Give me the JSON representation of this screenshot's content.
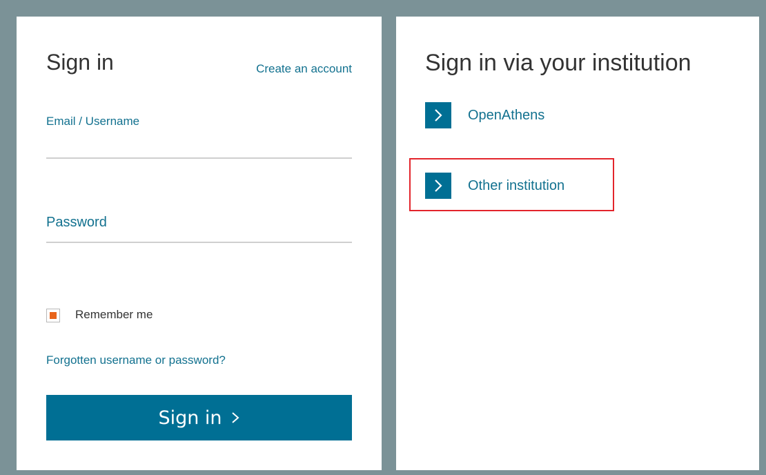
{
  "signin": {
    "title": "Sign in",
    "create_account_label": "Create an account",
    "email_label": "Email / Username",
    "email_value": "",
    "password_label": "Password",
    "password_value": "",
    "remember_label": "Remember me",
    "remember_checked": true,
    "forgot_label": "Forgotten username or password?",
    "button_label": "Sign in"
  },
  "institution": {
    "title": "Sign in via your institution",
    "items": [
      {
        "label": "OpenAthens",
        "icon": "chevron-right-icon"
      },
      {
        "label": "Other institution",
        "icon": "chevron-right-icon",
        "highlighted": true
      }
    ]
  },
  "colors": {
    "background": "#7b9297",
    "panel": "#ffffff",
    "accent": "#006f94",
    "link": "#12718f",
    "checkbox_fill": "#e8641b",
    "highlight": "#e3242b"
  }
}
